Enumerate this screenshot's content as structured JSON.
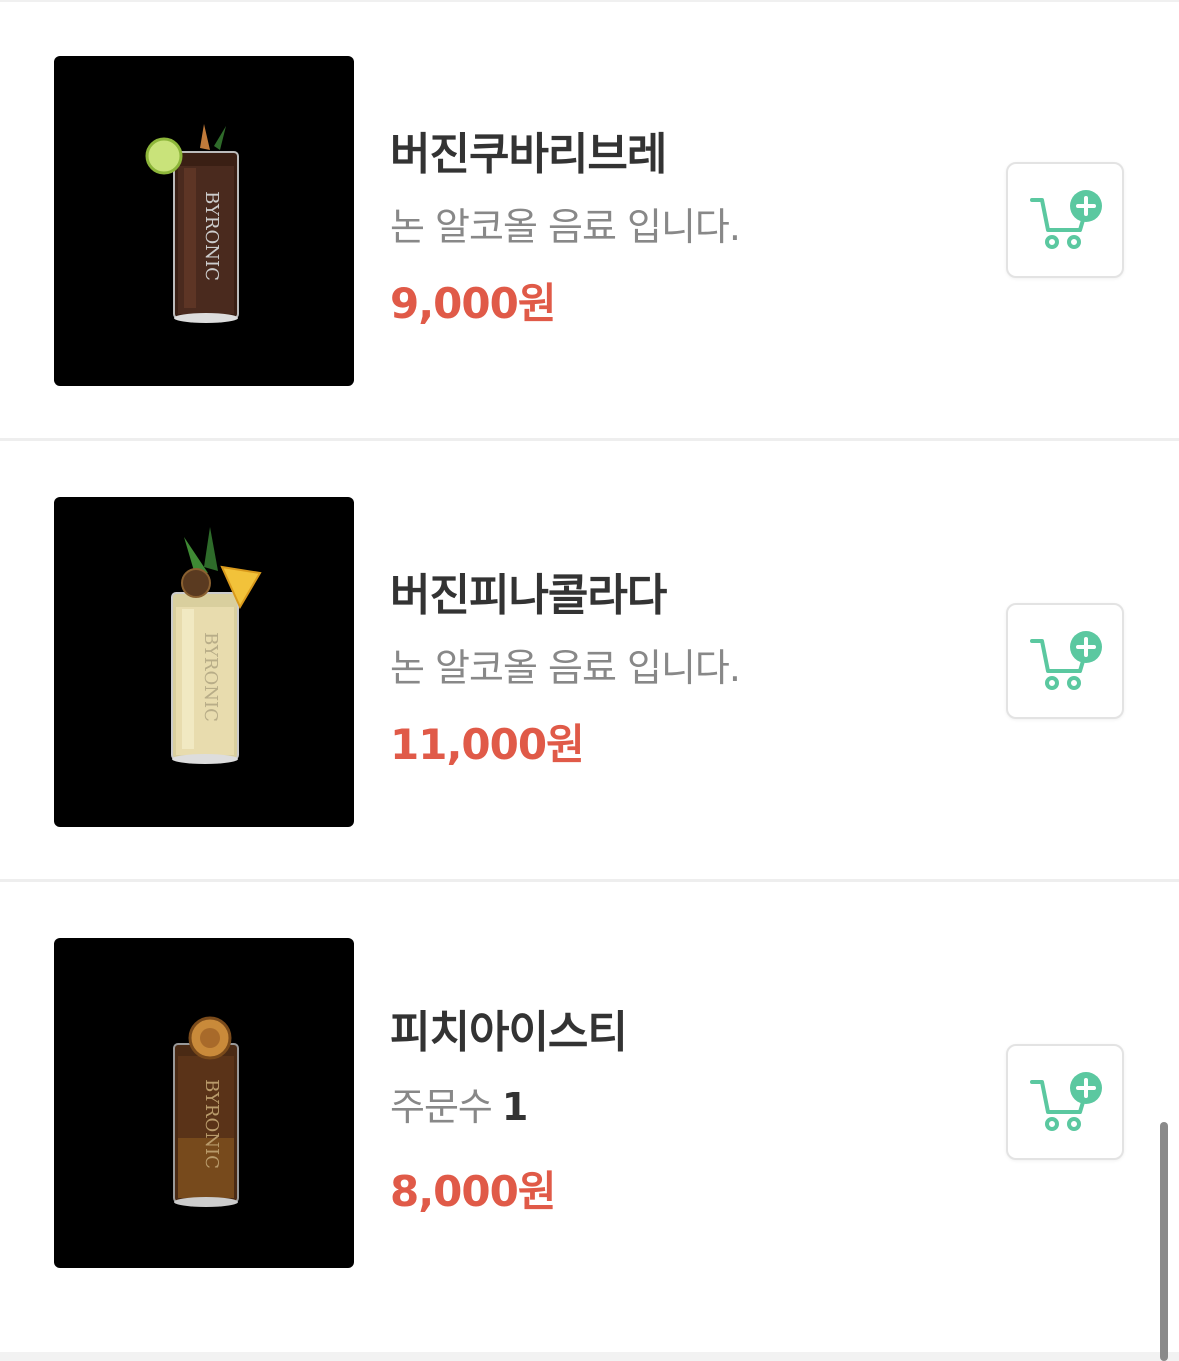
{
  "menu_items": [
    {
      "name": "버진쿠바리브레",
      "description": "논 알코올 음료 입니다.",
      "price": "9,000원",
      "image_label": "BYRONIC",
      "drink_color": "#4a2a1e",
      "garnish": "lime",
      "cart_icon": "cart-plus-icon"
    },
    {
      "name": "버진피나콜라다",
      "description": "논 알코올 음료 입니다.",
      "price": "11,000원",
      "image_label": "BYRONIC",
      "drink_color": "#e8dcae",
      "garnish": "pineapple",
      "cart_icon": "cart-plus-icon"
    },
    {
      "name": "피치아이스티",
      "order_count_label": "주문수",
      "order_count": "1",
      "price": "8,000원",
      "image_label": "BYRONIC",
      "drink_color": "#5a3318",
      "garnish": "dried-orange",
      "cart_icon": "cart-plus-icon"
    }
  ],
  "colors": {
    "price": "#e05a48",
    "cart_accent": "#5bc8a0",
    "title": "#333333",
    "description": "#888888"
  }
}
